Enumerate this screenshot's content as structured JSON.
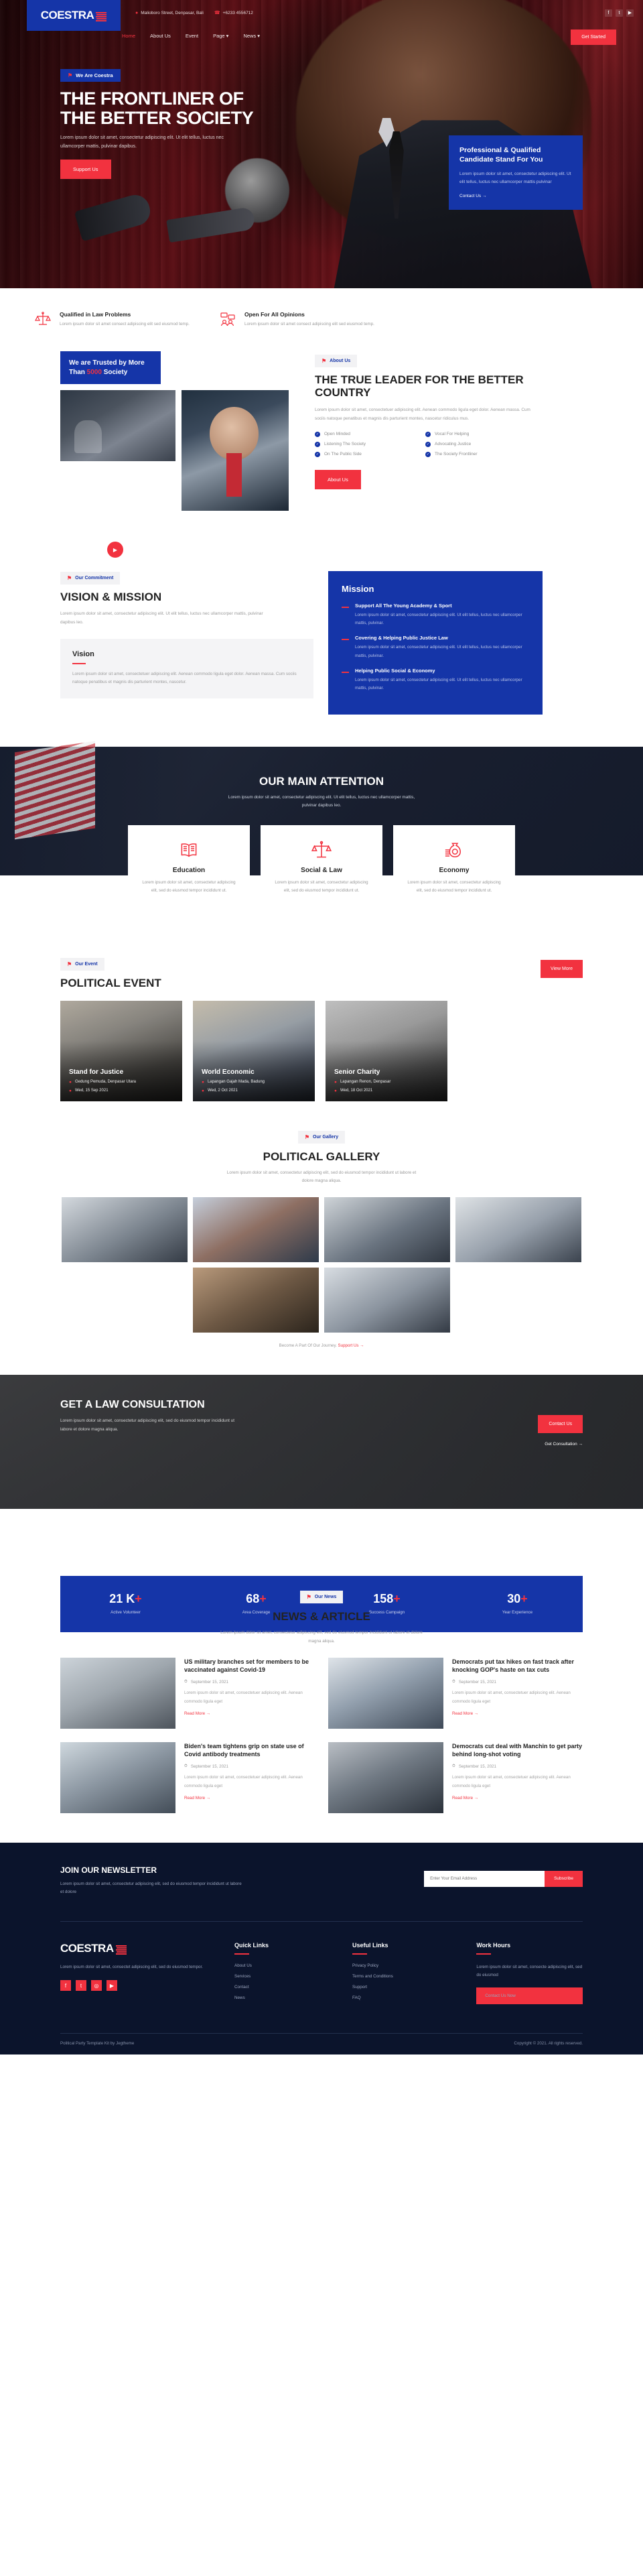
{
  "brand": {
    "name": "COESTRA",
    "logo_icon": "flag-stripes-icon"
  },
  "topbar": {
    "address": "Malioboro Street, Denpasar, Bali",
    "phone": "+6233 4556712",
    "address_icon": "map-pin-icon",
    "phone_icon": "phone-icon",
    "social": [
      {
        "name": "facebook-icon",
        "glyph": "f"
      },
      {
        "name": "twitter-icon",
        "glyph": "t"
      },
      {
        "name": "youtube-icon",
        "glyph": "▶"
      }
    ]
  },
  "nav": {
    "items": [
      {
        "label": "Home",
        "active": true
      },
      {
        "label": "About Us",
        "active": false
      },
      {
        "label": "Event",
        "active": false
      },
      {
        "label": "Page ▾",
        "active": false
      },
      {
        "label": "News ▾",
        "active": false
      }
    ],
    "cta": "Get Started"
  },
  "hero": {
    "tag": "We Are Coestra",
    "title_line1": "THE FRONTLINER OF",
    "title_line2": "THE BETTER SOCIETY",
    "paragraph": "Lorem ipsum dolor sit amet, consectetur adipiscing elit. Ut elit tellus, luctus nec ullamcorper mattis, pulvinar dapibus.",
    "button": "Support Us",
    "card": {
      "title": "Professional & Qualified Candidate Stand For You",
      "text": "Lorem ipsum dolor sit amet, consectetur adipiscing elit. Ut elit tellus, luctus nec ullamcorper mattis pulvinar",
      "link": "Contact Us  →"
    }
  },
  "features": [
    {
      "icon": "scales-of-justice-icon",
      "title": "Qualified in Law Problems",
      "text": "Lorem ipsum dolor sit amet consect adipiscing elit sed eiusmod temp."
    },
    {
      "icon": "people-speech-icon",
      "title": "Open For All Opinions",
      "text": "Lorem ipsum dolor sit amet consect adipiscing elit sed eiusmod temp."
    }
  ],
  "about": {
    "trusted_prefix": "We are Trusted by More Than ",
    "trusted_number": "5000",
    "trusted_suffix": " Society",
    "tag": "About Us",
    "title": "THE TRUE LEADER FOR THE BETTER COUNTRY",
    "paragraph": "Lorem ipsum dolor sit amet, consectetuer adipiscing elit. Aenean commodo ligula eget dolor. Aenean massa. Cum sociis natoque penatibus et magnis dis parturient montes, nascetur ridiculus mus.",
    "checklist": [
      "Open Minded",
      "Vocal For Helping",
      "Listening The Society",
      "Advocating Justice",
      "On The Public Side",
      "The Society Frontliner"
    ],
    "button": "About Us",
    "play_icon": "play-icon"
  },
  "vision": {
    "tag": "Our Commitment",
    "title": "VISION & MISSION",
    "lead": "Lorem ipsum dolor sit amet, consectetur adipiscing elit. Ut elit tellus, luctus nec ullamcorper mattis, pulvinar dapibus leo.",
    "vision_card": {
      "title": "Vision",
      "text": "Lorem ipsum dolor sit amet, consectetuer adipiscing elit. Aenean commodo ligula eget dolor. Aenean massa. Cum sociis natoque penatibus et magnis dis parturient montes, nascetur."
    },
    "mission_title": "Mission",
    "mission_items": [
      {
        "title": "Support All The Young Academy & Sport",
        "text": "Lorem ipsum dolor sit amet, consectetur adipiscing elit. Ut elit tellus, luctus nec ullamcorper mattis, pulvinar."
      },
      {
        "title": "Covering & Helping Public Justice Law",
        "text": "Lorem ipsum dolor sit amet, consectetur adipiscing elit. Ut elit tellus, luctus nec ullamcorper mattis, pulvinar."
      },
      {
        "title": "Helping Public Social & Economy",
        "text": "Lorem ipsum dolor sit amet, consectetur adipiscing elit. Ut elit tellus, luctus nec ullamcorper mattis, pulvinar."
      }
    ]
  },
  "attention": {
    "title": "OUR MAIN ATTENTION",
    "subtitle": "Lorem ipsum dolor sit amet, consectetur adipiscing elit. Ut elit tellus, luctus nec ullamcorper mattis, pulvinar dapibus leo.",
    "cards": [
      {
        "icon": "open-book-icon",
        "title": "Education",
        "text": "Lorem ipsum dolor sit amet, consectetur adipiscing elit, sed do eiusmod tempor incididunt ut."
      },
      {
        "icon": "scales-of-justice-icon",
        "title": "Social & Law",
        "text": "Lorem ipsum dolor sit amet, consectetur adipiscing elit, sed do eiusmod tempor incididunt ut."
      },
      {
        "icon": "money-bag-icon",
        "title": "Economy",
        "text": "Lorem ipsum dolor sit amet, consectetur adipiscing elit, sed do eiusmod tempor incididunt ut."
      }
    ]
  },
  "events": {
    "tag": "Our Event",
    "title": "POLITICAL EVENT",
    "button": "View More",
    "items": [
      {
        "title": "Stand for Justice",
        "location": "Gedung Pemuda, Denpasar Utara",
        "date": "Wed, 15 Sep 2021"
      },
      {
        "title": "World Economic",
        "location": "Lapangan Gajah Mada, Badung",
        "date": "Wed, 2 Oct 2021"
      },
      {
        "title": "Senior Charity",
        "location": "Lapangan Renon, Denpasar",
        "date": "Wed, 18 Oct 2021"
      }
    ]
  },
  "gallery": {
    "tag": "Our Gallery",
    "title": "POLITICAL GALLERY",
    "subtitle": "Lorem ipsum dolor sit amet, consectetur adipiscing elit, sed do eiusmod tempor incididunt ut labore et dolore magna aliqua.",
    "footer_text": "Become A Part Of Our Journey. ",
    "footer_link": "Support Us  →",
    "images": 6
  },
  "consultation": {
    "title": "GET A LAW CONSULTATION",
    "text": "Lorem ipsum dolor sit amet, consectetur adipiscing elit, sed do eiusmod tempor incididunt ut labore et dolore magna aliqua.",
    "button": "Contact Us",
    "link": "Get Consultation  →",
    "stats": [
      {
        "value": "21 K",
        "plus": "+",
        "label": "Active Volunteer"
      },
      {
        "value": "68",
        "plus": "+",
        "label": "Area Coverage"
      },
      {
        "value": "158",
        "plus": "+",
        "label": "Success Campaign"
      },
      {
        "value": "30",
        "plus": "+",
        "label": "Year Experience"
      }
    ]
  },
  "news": {
    "tag": "Our News",
    "title": "NEWS & ARTICLE",
    "subtitle": "Lorem ipsum dolor sit amet, consectetur adipiscing elit, sed do eiusmod tempor incididunt ut labore et dolore magna aliqua.",
    "items": [
      {
        "title": "US military branches set for members to be vaccinated against Covid-19",
        "date": "September 15, 2021",
        "excerpt": "Lorem ipsum dolor sit amet, consectetuer adipiscing elit. Aenean commodo ligula eget",
        "link": "Read More  →"
      },
      {
        "title": "Democrats put tax hikes on fast track after knocking GOP's haste on tax cuts",
        "date": "September 15, 2021",
        "excerpt": "Lorem ipsum dolor sit amet, consectetuer adipiscing elit. Aenean commodo ligula eget",
        "link": "Read More  →"
      },
      {
        "title": "Biden's team tightens grip on state use of Covid antibody treatments",
        "date": "September 15, 2021",
        "excerpt": "Lorem ipsum dolor sit amet, consectetuer adipiscing elit. Aenean commodo ligula eget",
        "link": "Read More  →"
      },
      {
        "title": "Democrats cut deal with Manchin to get party behind long-shot voting",
        "date": "September 15, 2021",
        "excerpt": "Lorem ipsum dolor sit amet, consectetuer adipiscing elit. Aenean commodo ligula eget",
        "link": "Read More  →"
      }
    ],
    "date_icon": "clock-icon"
  },
  "newsletter": {
    "title": "JOIN OUR NEWSLETTER",
    "text": "Lorem ipsum dolor sit amet, consectetur adipiscing elit, sed do eiusmod tempor incididunt ut labore et dolore",
    "placeholder": "Enter Your Email Address",
    "button": "Subscribe"
  },
  "footer": {
    "about_text": "Lorem ipsum dolor sit amet, consectet adipiscing elit, sed do eiusmod tempor.",
    "social": [
      {
        "name": "facebook-icon",
        "glyph": "f"
      },
      {
        "name": "twitter-icon",
        "glyph": "t"
      },
      {
        "name": "instagram-icon",
        "glyph": "◎"
      },
      {
        "name": "youtube-icon",
        "glyph": "▶"
      }
    ],
    "quick_links": {
      "title": "Quick Links",
      "items": [
        "About Us",
        "Services",
        "Contact",
        "News"
      ]
    },
    "useful_links": {
      "title": "Useful Links",
      "items": [
        "Privacy Policy",
        "Terms and Conditions",
        "Support",
        "FAQ"
      ]
    },
    "work_hours": {
      "title": "Work Hours",
      "text": "Lorem ipsum dolor sit amet, consecte adipiscing elit, sed do eiusmod",
      "button": "Contact Us Now"
    },
    "credit": "Political Party Template Kit by Jegtheme",
    "copyright": "Copyright © 2021. All rights reserved."
  },
  "colors": {
    "blue": "#1535a8",
    "red": "#f2323f",
    "dark": "#0b142c"
  }
}
